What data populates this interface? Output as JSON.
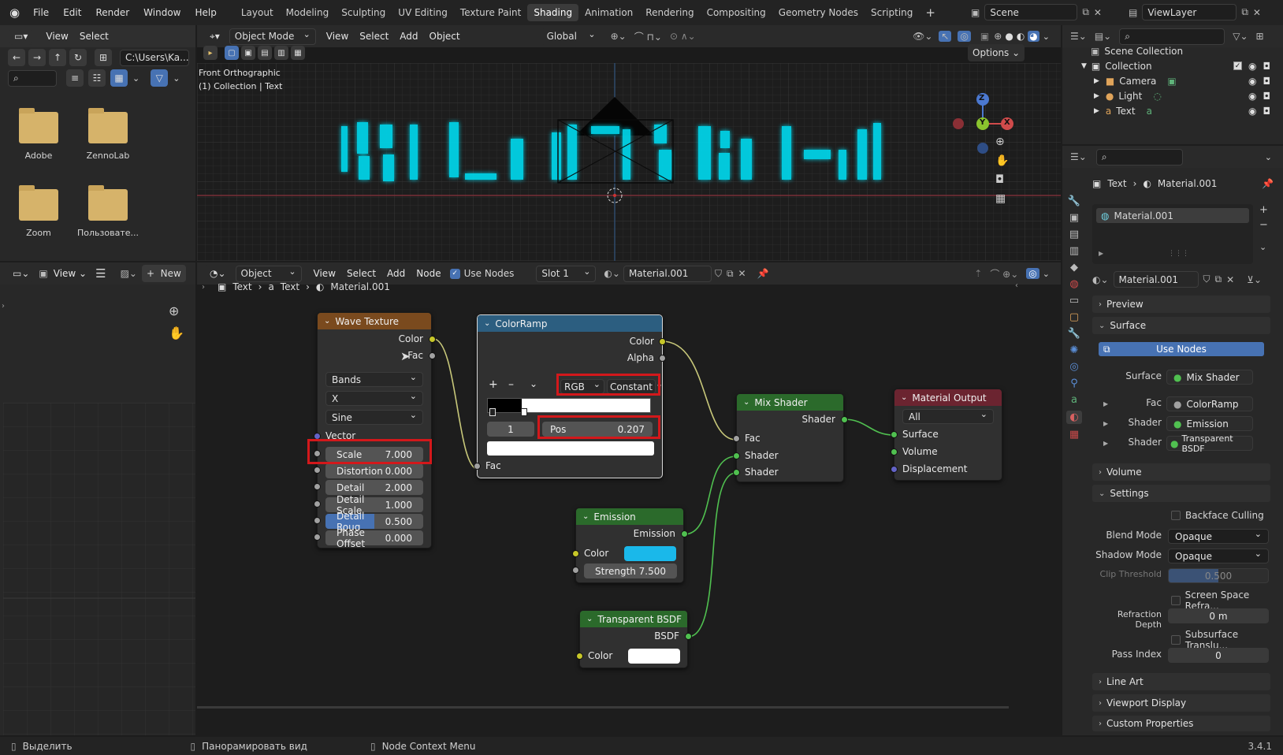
{
  "topbar": {
    "menus": [
      "File",
      "Edit",
      "Render",
      "Window",
      "Help"
    ],
    "workspaces": [
      "Layout",
      "Modeling",
      "Sculpting",
      "UV Editing",
      "Texture Paint",
      "Shading",
      "Animation",
      "Rendering",
      "Compositing",
      "Geometry Nodes",
      "Scripting"
    ],
    "active_workspace": "Shading",
    "add_tab": "+",
    "scene": "Scene",
    "view_layer": "ViewLayer"
  },
  "file_browser": {
    "menus": [
      "View",
      "Select"
    ],
    "path": "C:\\Users\\Ka...",
    "folders": [
      "Adobe",
      "ZennoLab",
      "Zoom",
      "Пользовате..."
    ]
  },
  "viewport": {
    "mode": "Object Mode",
    "menus": [
      "View",
      "Select",
      "Add",
      "Object"
    ],
    "orientation": "Global",
    "options": "Options",
    "view_name": "Front Orthographic",
    "collection_info": "(1) Collection | Text",
    "gizmo": {
      "z": "Z",
      "y": "Y",
      "x": "X"
    }
  },
  "image_editor": {
    "view": "View",
    "new": "New"
  },
  "node_editor": {
    "type": "Object",
    "menus": [
      "View",
      "Select",
      "Add",
      "Node"
    ],
    "use_nodes": "Use Nodes",
    "slot": "Slot 1",
    "material": "Material.001",
    "breadcrumb": [
      "Text",
      "Text",
      "Material.001"
    ]
  },
  "nodes": {
    "wave": {
      "title": "Wave Texture",
      "out_color": "Color",
      "out_fac": "Fac",
      "type": "Bands",
      "dir": "X",
      "profile": "Sine",
      "vector": "Vector",
      "fields": [
        {
          "label": "Scale",
          "value": "7.000"
        },
        {
          "label": "Distortion",
          "value": "0.000"
        },
        {
          "label": "Detail",
          "value": "2.000"
        },
        {
          "label": "Detail Scale",
          "value": "1.000"
        },
        {
          "label": "Detail Roug",
          "value": "0.500"
        },
        {
          "label": "Phase Offset",
          "value": "0.000"
        }
      ]
    },
    "ramp": {
      "title": "ColorRamp",
      "out_color": "Color",
      "out_alpha": "Alpha",
      "add": "+",
      "remove": "–",
      "mode": "RGB",
      "interp": "Constant",
      "index": "1",
      "pos_label": "Pos",
      "pos_value": "0.207",
      "in_fac": "Fac",
      "stop_position": 0.207
    },
    "mix": {
      "title": "Mix Shader",
      "out": "Shader",
      "fac": "Fac",
      "s1": "Shader",
      "s2": "Shader"
    },
    "output": {
      "title": "Material Output",
      "target": "All",
      "surface": "Surface",
      "volume": "Volume",
      "displacement": "Displacement"
    },
    "emission": {
      "title": "Emission",
      "out": "Emission",
      "color": "Color",
      "strength_label": "Strength",
      "strength": "7.500",
      "swatch": "#1ab8ea"
    },
    "transparent": {
      "title": "Transparent BSDF",
      "out": "BSDF",
      "color": "Color",
      "swatch": "#ffffff"
    }
  },
  "outliner": {
    "scene_collection": "Scene Collection",
    "items": [
      "Collection",
      "Camera",
      "Light",
      "Text"
    ]
  },
  "properties": {
    "object": "Text",
    "material": "Material.001",
    "slot_name": "Material.001",
    "mat_field": "Material.001",
    "sections": {
      "preview": "Preview",
      "surface": "Surface",
      "volume": "Volume",
      "settings": "Settings",
      "line_art": "Line Art",
      "viewport_display": "Viewport Display",
      "custom_properties": "Custom Properties"
    },
    "use_nodes": "Use Nodes",
    "surface_rows": [
      {
        "label": "Surface",
        "value": "Mix Shader"
      },
      {
        "label": "Fac",
        "value": "ColorRamp"
      },
      {
        "label": "Shader",
        "value": "Emission"
      },
      {
        "label": "Shader",
        "value": "Transparent BSDF"
      }
    ],
    "backface_culling": "Backface Culling",
    "blend_mode_label": "Blend Mode",
    "blend_mode": "Opaque",
    "shadow_mode_label": "Shadow Mode",
    "shadow_mode": "Opaque",
    "clip_label": "Clip Threshold",
    "clip_value": "0.500",
    "ssr": "Screen Space Refra...",
    "refraction_label": "Refraction Depth",
    "refraction_value": "0 m",
    "sss": "Subsurface Translu...",
    "pass_label": "Pass Index",
    "pass_value": "0"
  },
  "status": {
    "select": "Выделить",
    "pan": "Панорамировать вид",
    "context": "Node Context Menu",
    "version": "3.4.1"
  },
  "colors": {
    "accent": "#4772b3",
    "cyan_text": "#00e5ff",
    "wave_header": "#7a4a1e",
    "ramp_header": "#2c5e80",
    "shader_header": "#2b6a2b",
    "output_header": "#6b2430",
    "highlight": "#d3181b"
  }
}
